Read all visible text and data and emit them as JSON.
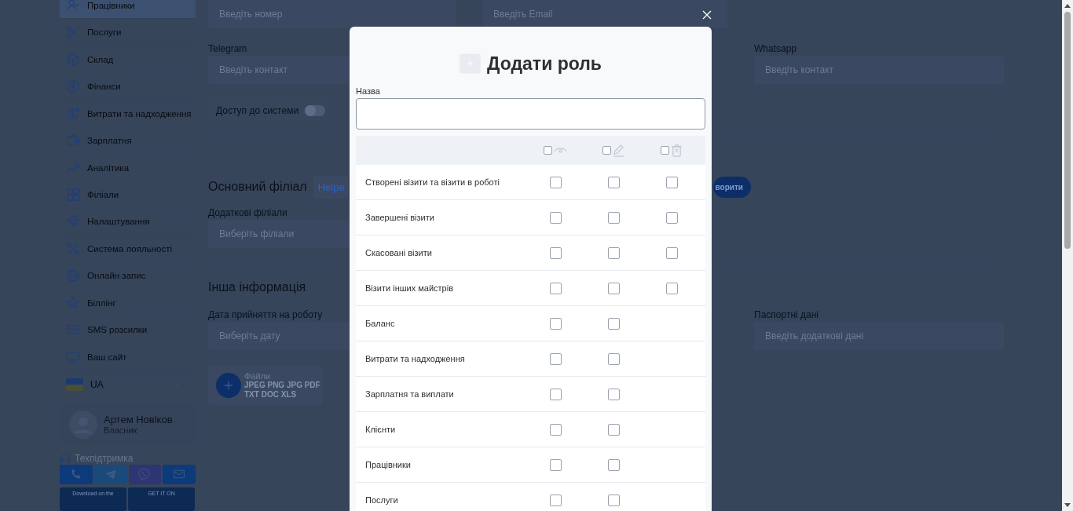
{
  "sidebar": {
    "items": [
      {
        "label": "Працівники",
        "selected": true
      },
      {
        "label": "Послуги",
        "selected": false
      },
      {
        "label": "Склад",
        "selected": false
      },
      {
        "label": "Фінанси",
        "selected": false
      },
      {
        "label": "Витрати та надходження",
        "selected": false
      },
      {
        "label": "Зарплатня",
        "selected": false
      },
      {
        "label": "Аналітика",
        "selected": false
      },
      {
        "label": "Філіали",
        "selected": false
      },
      {
        "label": "Налаштування",
        "selected": false
      },
      {
        "label": "Система лояльності",
        "selected": false
      },
      {
        "label": "Онлайн запис",
        "selected": false
      },
      {
        "label": "Біллінг",
        "selected": false
      },
      {
        "label": "SMS розсилки",
        "selected": false
      },
      {
        "label": "Ваш сайт",
        "selected": false
      }
    ],
    "language": {
      "code": "UA"
    },
    "user": {
      "name": "Артем Новіков",
      "role": "Власник"
    },
    "support": {
      "label": "Техпідтримка"
    },
    "stores": [
      {
        "caption": "Download on the"
      },
      {
        "caption": "GET IT ON"
      }
    ]
  },
  "form": {
    "top_fields": [
      {
        "placeholder": "Введіть номер"
      },
      {
        "placeholder": "Введіть Email"
      }
    ],
    "contacts": [
      {
        "label": "Telegram",
        "placeholder": "Введіть контакт"
      },
      {
        "label": "Whatsapp",
        "placeholder": "Введіть контакт"
      }
    ],
    "access": {
      "label": "Доступ до системи",
      "on": false
    },
    "branch": {
      "heading": "Основний філіал",
      "tab": "Helpe",
      "button": "ворити"
    },
    "extra_branches": {
      "label": "Додаткові філіали",
      "placeholder": "Виберіть філіали"
    },
    "other": {
      "heading": "Інша інформація"
    },
    "hire_date": {
      "label": "Дата прийняття на роботу",
      "placeholder": "Виберіть дату"
    },
    "passport": {
      "label": "Паспортні дані",
      "placeholder": "Введіть додаткові дані"
    },
    "files": {
      "title": "Файли",
      "formats": "JPEG PNG JPG PDF TXT DOC XLS"
    }
  },
  "modal": {
    "title": "Додати роль",
    "name_label": "Назва",
    "header": [
      {
        "checked": false
      },
      {
        "checked": false
      },
      {
        "checked": false
      }
    ],
    "rows": [
      {
        "label": "Створені візити та візити в роботі",
        "perms": [
          {
            "checked": false
          },
          {
            "checked": false
          },
          {
            "checked": false
          }
        ]
      },
      {
        "label": "Завершені візити",
        "perms": [
          {
            "checked": false
          },
          {
            "checked": false
          },
          {
            "checked": false
          }
        ]
      },
      {
        "label": "Скасовані візити",
        "perms": [
          {
            "checked": false
          },
          {
            "checked": false
          },
          {
            "checked": false
          }
        ]
      },
      {
        "label": "Візити інших майстрів",
        "perms": [
          {
            "checked": false
          },
          {
            "checked": false
          },
          {
            "checked": false
          }
        ]
      },
      {
        "label": "Баланс",
        "perms": [
          {
            "checked": false
          },
          {
            "checked": false
          }
        ]
      },
      {
        "label": "Витрати та надходження",
        "perms": [
          {
            "checked": false
          },
          {
            "checked": false
          }
        ]
      },
      {
        "label": "Зарплатня та виплати",
        "perms": [
          {
            "checked": false
          },
          {
            "checked": false
          }
        ]
      },
      {
        "label": "Клієнти",
        "perms": [
          {
            "checked": false
          },
          {
            "checked": false
          }
        ]
      },
      {
        "label": "Працівники",
        "perms": [
          {
            "checked": false
          },
          {
            "checked": false
          }
        ]
      },
      {
        "label": "Послуги",
        "perms": [
          {
            "checked": false
          },
          {
            "checked": false
          }
        ]
      }
    ]
  }
}
